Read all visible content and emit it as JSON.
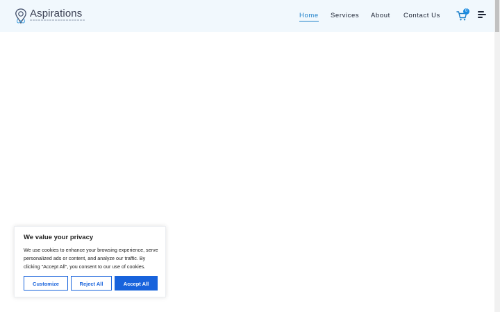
{
  "header": {
    "logo_text": "Aspirations",
    "nav": [
      {
        "label": "Home",
        "active": true
      },
      {
        "label": "Services",
        "active": false
      },
      {
        "label": "About",
        "active": false
      },
      {
        "label": "Contact Us",
        "active": false
      }
    ],
    "cart_count": "0",
    "accent_color": "#1b7fc9",
    "background_color": "#f1f8fd"
  },
  "cookie_banner": {
    "title": "We value your privacy",
    "text": "We use cookies to enhance your browsing experience, serve personalized ads or content, and analyze our traffic. By clicking \"Accept All\", you consent to our use of cookies.",
    "buttons": {
      "customize": "Customize",
      "reject": "Reject All",
      "accept": "Accept All"
    },
    "button_color": "#1863dc"
  },
  "icons": {
    "logo": "balloon-logo-icon",
    "cart": "shopping-cart-icon",
    "menu": "hamburger-menu-icon"
  }
}
